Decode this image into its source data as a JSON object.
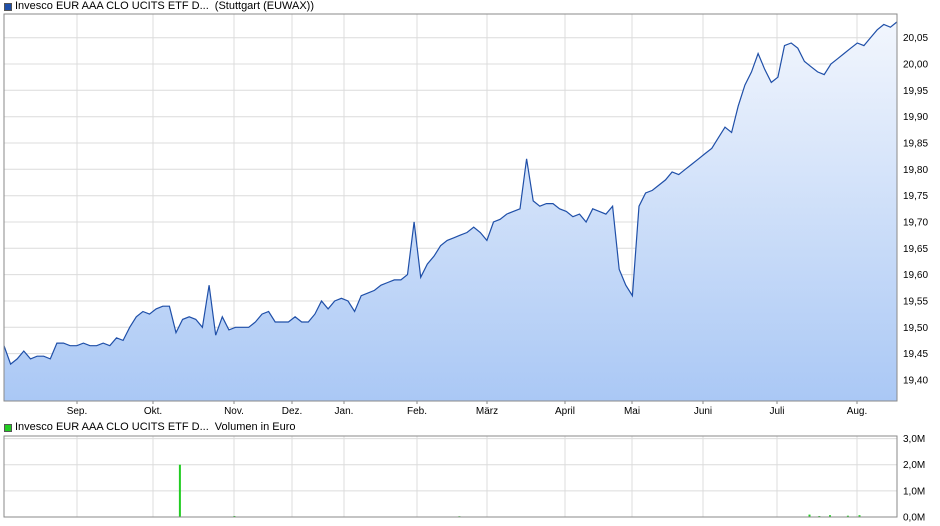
{
  "colors": {
    "price_line": "#1f4fa8",
    "price_fill_top": "#f2f6fd",
    "price_fill_bottom": "#aac8f5",
    "volume_bar": "#22cc22",
    "grid": "#dcdcdc",
    "frame": "#8a8a8a"
  },
  "legend": {
    "price": {
      "name": "Invesco EUR AAA CLO UCITS ETF D...",
      "info": "(Stuttgart (EUWAX))"
    },
    "volume": {
      "name": "Invesco EUR AAA CLO UCITS ETF D...",
      "info": "Volumen in Euro"
    }
  },
  "chart_data": [
    {
      "type": "line",
      "fill": "area-gradient",
      "grid": true,
      "x_axis_labels": [
        "Sep.",
        "Okt.",
        "Nov.",
        "Dez.",
        "Jan.",
        "Feb.",
        "März",
        "April",
        "Mai",
        "Juni",
        "Juli",
        "Aug."
      ],
      "y_ticks": [
        19.4,
        19.45,
        19.5,
        19.55,
        19.6,
        19.65,
        19.7,
        19.75,
        19.8,
        19.85,
        19.9,
        19.95,
        20.0,
        20.05
      ],
      "y_tick_labels": [
        "19,40",
        "19,45",
        "19,50",
        "19,55",
        "19,60",
        "19,65",
        "19,70",
        "19,75",
        "19,80",
        "19,85",
        "19,90",
        "19,95",
        "20,00",
        "20,05"
      ],
      "ylim": [
        19.36,
        20.095
      ],
      "series": [
        {
          "name": "Invesco EUR AAA CLO UCITS ETF D...",
          "values": [
            19.465,
            19.43,
            19.44,
            19.455,
            19.44,
            19.445,
            19.445,
            19.44,
            19.47,
            19.47,
            19.465,
            19.465,
            19.47,
            19.465,
            19.465,
            19.47,
            19.465,
            19.48,
            19.475,
            19.5,
            19.52,
            19.53,
            19.525,
            19.535,
            19.54,
            19.54,
            19.49,
            19.515,
            19.52,
            19.515,
            19.5,
            19.58,
            19.485,
            19.52,
            19.495,
            19.5,
            19.5,
            19.5,
            19.51,
            19.525,
            19.53,
            19.51,
            19.51,
            19.51,
            19.52,
            19.51,
            19.51,
            19.525,
            19.55,
            19.535,
            19.55,
            19.555,
            19.55,
            19.53,
            19.56,
            19.565,
            19.57,
            19.58,
            19.585,
            19.59,
            19.59,
            19.6,
            19.7,
            19.595,
            19.62,
            19.635,
            19.655,
            19.665,
            19.67,
            19.675,
            19.68,
            19.69,
            19.68,
            19.665,
            19.7,
            19.705,
            19.715,
            19.72,
            19.725,
            19.82,
            19.74,
            19.73,
            19.735,
            19.735,
            19.725,
            19.72,
            19.71,
            19.715,
            19.7,
            19.725,
            19.72,
            19.715,
            19.73,
            19.61,
            19.58,
            19.56,
            19.73,
            19.755,
            19.76,
            19.77,
            19.78,
            19.795,
            19.79,
            19.8,
            19.81,
            19.82,
            19.83,
            19.84,
            19.86,
            19.88,
            19.87,
            19.92,
            19.96,
            19.985,
            20.02,
            19.99,
            19.965,
            19.975,
            20.035,
            20.04,
            20.03,
            20.005,
            19.995,
            19.985,
            19.98,
            20.0,
            20.01,
            20.02,
            20.03,
            20.04,
            20.035,
            20.05,
            20.065,
            20.075,
            20.07,
            20.08
          ]
        }
      ]
    },
    {
      "type": "bar",
      "grid": true,
      "ylabel": "Volumen in Euro",
      "y_ticks": [
        0,
        1,
        2,
        3
      ],
      "y_tick_labels": [
        "0,0M",
        "1,0M",
        "2,0M",
        "3,0M"
      ],
      "ylim": [
        0,
        3.1
      ],
      "x_domain": [
        0,
        1
      ],
      "series": [
        {
          "name": "Invesco EUR AAA CLO UCITS ETF D...",
          "x": [
            0.197,
            0.258,
            0.51,
            0.902,
            0.913,
            0.925,
            0.945,
            0.958
          ],
          "values": [
            2.0,
            0.04,
            0.03,
            0.09,
            0.04,
            0.07,
            0.05,
            0.07
          ]
        }
      ]
    }
  ]
}
